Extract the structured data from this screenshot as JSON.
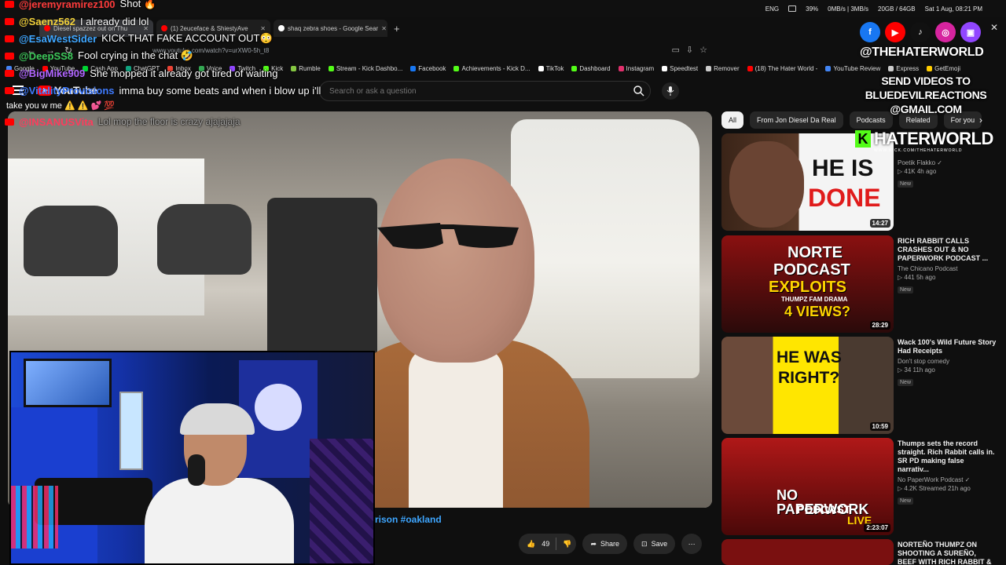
{
  "taskbar": {
    "lang": "ENG",
    "battery": "39%",
    "net": "0MB/s | 3MB/s",
    "memory": "20GB / 64GB",
    "datetime": "Sat 1 Aug, 08:21 PM"
  },
  "browser": {
    "tabs": [
      {
        "label": "Diesel spazzez out on Thu",
        "icon": "youtube-icon"
      },
      {
        "label": "(1) 2euceface & ShiestyAve",
        "icon": "youtube-icon"
      },
      {
        "label": "shaq zebra shoes - Google Sear",
        "icon": "google-icon"
      }
    ],
    "url": "www.youtube.com/watch?v=urXW0-5h_t8",
    "bookmarks": [
      {
        "label": "Google",
        "color": "#4285f4"
      },
      {
        "label": "YouTube",
        "color": "#ff0000"
      },
      {
        "label": "Cash App",
        "color": "#00d632"
      },
      {
        "label": "ChatGPT",
        "color": "#10a37f"
      },
      {
        "label": "Inbox",
        "color": "#ea4335"
      },
      {
        "label": "Voice",
        "color": "#34a853"
      },
      {
        "label": "Twitch",
        "color": "#9146ff"
      },
      {
        "label": "Kick",
        "color": "#53fc18"
      },
      {
        "label": "Rumble",
        "color": "#85c742"
      },
      {
        "label": "Stream - Kick Dashbo...",
        "color": "#53fc18"
      },
      {
        "label": "Facebook",
        "color": "#1877f2"
      },
      {
        "label": "Achievements - Kick D...",
        "color": "#53fc18"
      },
      {
        "label": "TikTok",
        "color": "#ffffff"
      },
      {
        "label": "Dashboard",
        "color": "#53fc18"
      },
      {
        "label": "Instagram",
        "color": "#e1306c"
      },
      {
        "label": "Speedtest",
        "color": "#ffffff"
      },
      {
        "label": "Remover",
        "color": "#cccccc"
      },
      {
        "label": "(18) The Hater World -",
        "color": "#ff0000"
      },
      {
        "label": "YouTube Review",
        "color": "#4285f4"
      },
      {
        "label": "Express",
        "color": "#cccccc"
      },
      {
        "label": "GetEmoji",
        "color": "#ffcc00"
      }
    ]
  },
  "youtube": {
    "logo_text": "YouTube",
    "search_placeholder": "Search or ask a question",
    "video_title_fragment": "rison #oakland",
    "likes": "49",
    "share_label": "Share",
    "save_label": "Save"
  },
  "chat": [
    {
      "user": "@jeremyramirez100",
      "msg": "Shot 🔥",
      "color": "#ff3b3b",
      "dim": false
    },
    {
      "user": "@Saenz562",
      "msg": "I already did lol",
      "color": "#f2d13a",
      "dim": false
    },
    {
      "user": "@EsaWestSider",
      "msg": "KICK THAT FAKE ACCOUNT OUT😳",
      "color": "#3ea6ff",
      "dim": false
    },
    {
      "user": "@DeepSS8",
      "msg": "Fool crying in the chat 🤣",
      "color": "#3cc85a",
      "dim": false
    },
    {
      "user": "@BigMike909",
      "msg": "She mopped it already got tired of waiting",
      "color": "#b065ff",
      "dim": false
    },
    {
      "user": "@VitalityProvisions",
      "msg": "imma buy some beats and when i blow up i'll",
      "color": "#3e7bff",
      "dim": false
    },
    {
      "user": "@INSANUSVita",
      "msg": "Lol mop the floor is crazy ajajajaja",
      "color": "#ff3b5c",
      "dim": true
    }
  ],
  "chat_wrap": "take you w me ⚠️ ⚠️ 💕 💯",
  "chips": [
    {
      "label": "All",
      "active": true
    },
    {
      "label": "From Jon Diesel Da Real",
      "active": false
    },
    {
      "label": "Podcasts",
      "active": false
    },
    {
      "label": "Related",
      "active": false
    },
    {
      "label": "For you",
      "active": false
    }
  ],
  "recommendations": [
    {
      "title": "",
      "channel": "Poetik Flakko ✓",
      "stats": "▷ 41K  4h ago",
      "badge": "New",
      "duration": "14:27",
      "thumb_text": [
        "HE IS",
        "DONE"
      ]
    },
    {
      "title": "RICH RABBIT CALLS CRASHES OUT & NO PAPERWORK PODCAST ...",
      "channel": "The Chicano Podcast",
      "stats": "▷ 441  5h ago",
      "badge": "New",
      "duration": "28:29",
      "thumb_text": [
        "NORTE",
        "PODCAST",
        "EXPLOITS",
        "THUMPZ FAM DRAMA",
        "4 VIEWS?"
      ]
    },
    {
      "title": "Wack 100's Wild Future Story Had Receipts",
      "channel": "Don't stop comedy",
      "stats": "▷ 34  11h ago",
      "badge": "New",
      "duration": "10:59",
      "thumb_text": [
        "HE WAS",
        "RIGHT?"
      ]
    },
    {
      "title": "Thumps sets the record straight. Rich Rabbit calls in. SR PD making false narrativ...",
      "channel": "No PaperWork Podcast ✓",
      "stats": "▷ 4.2K  Streamed 21h ago",
      "badge": "New",
      "duration": "2:23:07",
      "thumb_text": [
        "NO PAPERWORK",
        "PODCAST",
        "LIVE"
      ]
    },
    {
      "title": "NORTEÑO THUMPZ ON SHOOTING A SUREÑO, BEEF WITH RICH RABBIT & THE ...",
      "channel": "",
      "stats": "",
      "badge": "",
      "duration": "",
      "thumb_text": []
    }
  ],
  "overlay": {
    "handle": "@THEHATERWORLD",
    "send_lines": [
      "SEND VIDEOS TO",
      "BLUEDEVILREACTIONS",
      "@GMAIL.COM"
    ],
    "brand": "HATERWORLD",
    "brand_sub": "WWW.KICK.COM/THEHATERWORLD",
    "socials": [
      {
        "icon": "facebook-icon",
        "glyph": "f",
        "color": "#1877f2"
      },
      {
        "icon": "youtube-icon",
        "glyph": "▶",
        "color": "#ff0000"
      },
      {
        "icon": "tiktok-icon",
        "glyph": "♪",
        "color": "#111111"
      },
      {
        "icon": "instagram-icon",
        "glyph": "◎",
        "color": "#d6249f"
      },
      {
        "icon": "twitch-icon",
        "glyph": "▣",
        "color": "#9146ff"
      }
    ]
  }
}
